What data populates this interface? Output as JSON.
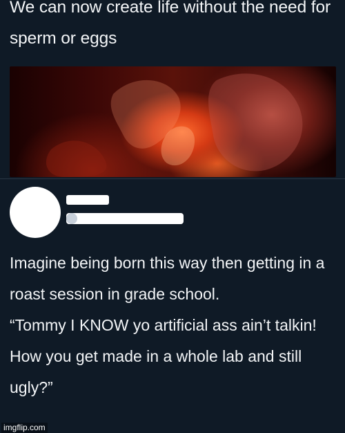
{
  "post": {
    "headline": "We can now create life without the need for sperm or eggs",
    "reply_text": "Imagine being born this way then getting in a roast session in grade school.\n“Tommy I KNOW yo artificial ass ain’t talkin! How you get made in a whole lab and still ugly?”"
  },
  "watermark": {
    "text": "imgflip.com"
  }
}
